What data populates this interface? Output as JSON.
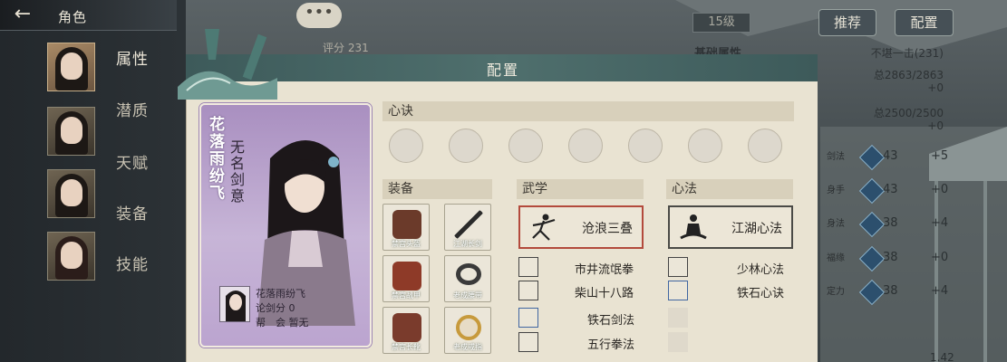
{
  "header": {
    "title": "角色"
  },
  "sidebar": {
    "tabs": [
      "属性",
      "潜质",
      "天赋",
      "装备",
      "技能"
    ]
  },
  "background": {
    "level": "15级",
    "btn_recommend": "推荐",
    "btn_config": "配置",
    "score": "评分 231",
    "base_attr": "基础属性",
    "right_title": "不堪一击(231)",
    "hp": "总2863/2863",
    "hp_plus": "+0",
    "mp": "总2500/2500",
    "mp_plus": "+0",
    "stats": [
      {
        "label": "剑法",
        "value": "43",
        "plus": "+5"
      },
      {
        "label": "身手",
        "value": "43",
        "plus": "+0"
      },
      {
        "label": "身法",
        "value": "38",
        "plus": "+4"
      },
      {
        "label": "福缘",
        "value": "38",
        "plus": "+0"
      },
      {
        "label": "定力",
        "value": "38",
        "plus": "+4"
      }
    ],
    "bottom_value": "1.42"
  },
  "modal": {
    "title": "配置",
    "character": {
      "name": "花落雨纷飞",
      "title": "无名剑意",
      "small_name": "花落雨纷飞",
      "rank": "论剑分 0",
      "guild": "帮　会 暂无"
    },
    "xinjue": {
      "label": "心诀"
    },
    "equipment": {
      "label": "装备",
      "items": [
        "禁宫头盔",
        "江湖长剑",
        "禁宫战甲",
        "老成腰带",
        "禁宫长靴",
        "老成戒指"
      ]
    },
    "martial": {
      "label": "武学",
      "main": "沧浪三叠",
      "list": [
        "市井流氓拳",
        "柴山十八路",
        "铁石剑法",
        "五行拳法"
      ]
    },
    "inner": {
      "label": "心法",
      "main": "江湖心法",
      "list": [
        "少林心法",
        "铁石心诀"
      ]
    }
  }
}
